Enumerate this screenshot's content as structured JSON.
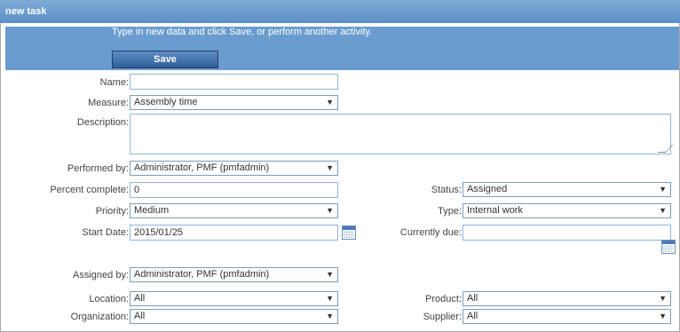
{
  "window": {
    "title": "new task"
  },
  "banner": {
    "message": "Type in new data and click Save, or perform another activity.",
    "save_label": "Save"
  },
  "form": {
    "name": {
      "label": "Name:",
      "value": ""
    },
    "measure": {
      "label": "Measure:",
      "value": "Assembly time"
    },
    "description": {
      "label": "Description:",
      "value": ""
    },
    "performed_by": {
      "label": "Performed by:",
      "value": "Administrator, PMF (pmfadmin)"
    },
    "percent_complete": {
      "label": "Percent complete:",
      "value": "0"
    },
    "status": {
      "label": "Status:",
      "value": "Assigned"
    },
    "priority": {
      "label": "Priority:",
      "value": "Medium"
    },
    "type": {
      "label": "Type:",
      "value": "Internal work"
    },
    "start_date": {
      "label": "Start Date:",
      "value": "2015/01/25"
    },
    "currently_due": {
      "label": "Currently due:",
      "value": ""
    },
    "assigned_by": {
      "label": "Assigned by:",
      "value": "Administrator, PMF (pmfadmin)"
    },
    "location": {
      "label": "Location:",
      "value": "All"
    },
    "product": {
      "label": "Product:",
      "value": "All"
    },
    "organization": {
      "label": "Organization:",
      "value": "All"
    },
    "supplier": {
      "label": "Supplier:",
      "value": "All"
    }
  },
  "icons": {
    "dropdown": "chevron-down-icon",
    "calendar": "calendar-icon"
  }
}
